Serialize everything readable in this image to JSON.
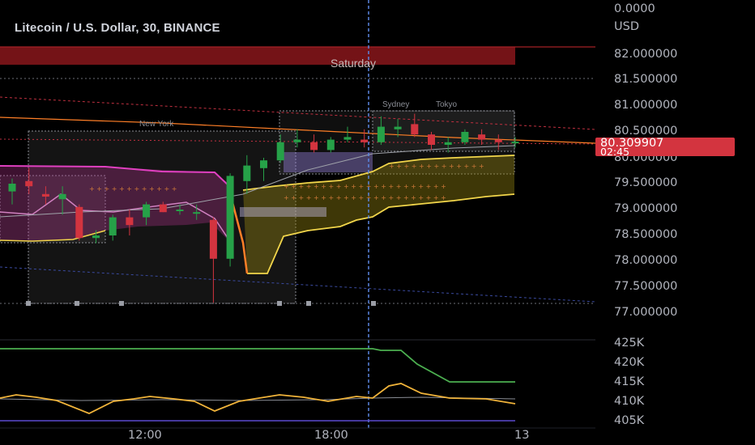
{
  "header": {
    "title": "Litecoin / U.S. Dollar, 30, BINANCE"
  },
  "price_axis": {
    "top_value": "0.0000",
    "currency": "USD",
    "ticks": [
      "82.000000",
      "81.500000",
      "81.000000",
      "80.500000",
      "80.000000",
      "79.500000",
      "79.000000",
      "78.500000",
      "78.000000",
      "77.500000",
      "77.000000"
    ]
  },
  "last_price": {
    "value": "80.309907",
    "countdown": "02:45",
    "color": "#d3343f"
  },
  "volume_axis": {
    "ticks": [
      "425K",
      "420K",
      "415K",
      "410K",
      "405K"
    ]
  },
  "time_axis": {
    "labels": [
      "12:00",
      "18:00",
      "13"
    ]
  },
  "sessions": {
    "new_york": "New York",
    "sydney": "Sydney",
    "tokyo": "Tokyo",
    "day_banner": "Saturday"
  },
  "colors": {
    "up": "#26a148",
    "down": "#d3343f",
    "band_magenta": "#e040c0",
    "band_yellow": "#f2d64b",
    "band_orange": "#ff7f27",
    "obv_green": "#4caf50",
    "osc_orange": "#f0b33a"
  },
  "chart_data": {
    "type": "candlestick",
    "title": "Litecoin / U.S. Dollar, 30, BINANCE",
    "ylabel": "USD",
    "ylim": [
      77.0,
      82.0
    ],
    "candles": [
      {
        "o": 79.35,
        "h": 79.6,
        "l": 79.1,
        "c": 79.5
      },
      {
        "o": 79.55,
        "h": 79.8,
        "l": 79.3,
        "c": 79.45
      },
      {
        "o": 79.3,
        "h": 79.45,
        "l": 79.1,
        "c": 79.25
      },
      {
        "o": 79.2,
        "h": 79.45,
        "l": 78.9,
        "c": 79.3
      },
      {
        "o": 79.05,
        "h": 79.1,
        "l": 78.4,
        "c": 78.45
      },
      {
        "o": 78.45,
        "h": 78.6,
        "l": 78.35,
        "c": 78.5
      },
      {
        "o": 78.5,
        "h": 78.9,
        "l": 78.4,
        "c": 78.85
      },
      {
        "o": 78.85,
        "h": 79.0,
        "l": 78.5,
        "c": 78.7
      },
      {
        "o": 78.85,
        "h": 79.15,
        "l": 78.7,
        "c": 79.1
      },
      {
        "o": 79.1,
        "h": 79.15,
        "l": 78.95,
        "c": 78.95
      },
      {
        "o": 79.0,
        "h": 79.1,
        "l": 78.9,
        "c": 79.0
      },
      {
        "o": 78.95,
        "h": 79.1,
        "l": 78.8,
        "c": 78.95
      },
      {
        "o": 78.8,
        "h": 78.85,
        "l": 77.2,
        "c": 78.05
      },
      {
        "o": 78.05,
        "h": 79.7,
        "l": 77.9,
        "c": 79.65
      },
      {
        "o": 79.55,
        "h": 80.05,
        "l": 79.3,
        "c": 79.85
      },
      {
        "o": 79.8,
        "h": 80.0,
        "l": 79.55,
        "c": 79.95
      },
      {
        "o": 79.95,
        "h": 80.45,
        "l": 79.9,
        "c": 80.3
      },
      {
        "o": 80.3,
        "h": 80.55,
        "l": 80.2,
        "c": 80.35
      },
      {
        "o": 80.3,
        "h": 80.45,
        "l": 80.1,
        "c": 80.15
      },
      {
        "o": 80.15,
        "h": 80.4,
        "l": 80.1,
        "c": 80.35
      },
      {
        "o": 80.35,
        "h": 80.6,
        "l": 80.3,
        "c": 80.4
      },
      {
        "o": 80.35,
        "h": 80.55,
        "l": 80.2,
        "c": 80.3
      },
      {
        "o": 80.3,
        "h": 80.8,
        "l": 80.25,
        "c": 80.6
      },
      {
        "o": 80.55,
        "h": 80.75,
        "l": 80.4,
        "c": 80.6
      },
      {
        "o": 80.65,
        "h": 80.85,
        "l": 80.4,
        "c": 80.45
      },
      {
        "o": 80.45,
        "h": 80.5,
        "l": 80.15,
        "c": 80.25
      },
      {
        "o": 80.25,
        "h": 80.4,
        "l": 80.1,
        "c": 80.3
      },
      {
        "o": 80.3,
        "h": 80.55,
        "l": 80.25,
        "c": 80.5
      },
      {
        "o": 80.45,
        "h": 80.55,
        "l": 80.25,
        "c": 80.35
      },
      {
        "o": 80.35,
        "h": 80.45,
        "l": 80.15,
        "c": 80.3
      },
      {
        "o": 80.3,
        "h": 80.4,
        "l": 80.2,
        "c": 80.31
      }
    ]
  }
}
